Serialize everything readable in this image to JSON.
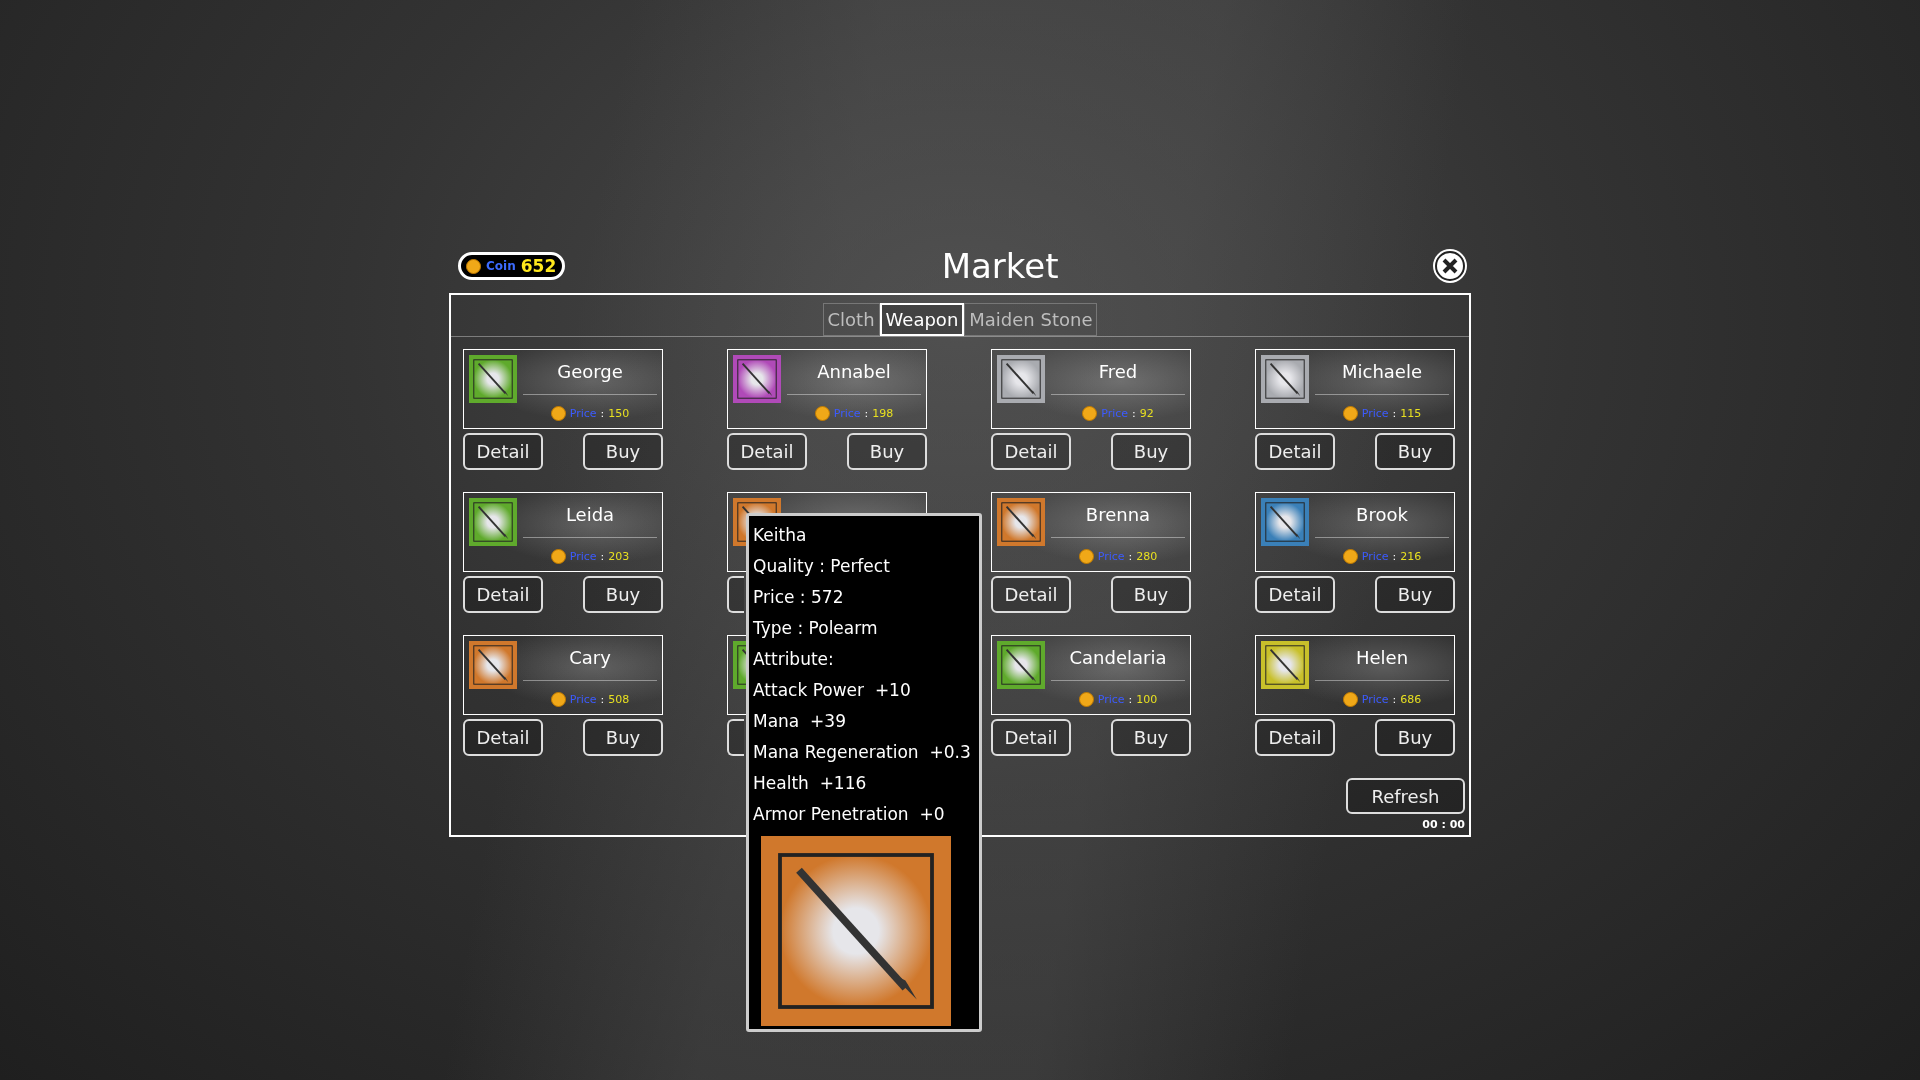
{
  "coin": {
    "label": "Coin",
    "amount": "652"
  },
  "title": "Market",
  "tabs": [
    {
      "label": "Cloth",
      "selected": false
    },
    {
      "label": "Weapon",
      "selected": true
    },
    {
      "label": "Maiden Stone",
      "selected": false
    }
  ],
  "items": [
    {
      "name": "George",
      "color": "#5faa2c",
      "price_label": "Price",
      "separator": ":",
      "price": "150",
      "buttons": [
        "Detail",
        "Buy"
      ]
    },
    {
      "name": "Annabel",
      "color": "#b04ab8",
      "price_label": "Price",
      "separator": ":",
      "price": "198",
      "buttons": [
        "Detail",
        "Buy"
      ]
    },
    {
      "name": "Fred",
      "color": "#a9abb0",
      "price_label": "Price",
      "separator": ":",
      "price": "92",
      "buttons": [
        "Detail",
        "Buy"
      ]
    },
    {
      "name": "Michaele",
      "color": "#a9abb0",
      "price_label": "Price",
      "separator": ":",
      "price": "115",
      "buttons": [
        "Detail",
        "Buy"
      ]
    },
    {
      "name": "Leida",
      "color": "#5faa2c",
      "price_label": "Price",
      "separator": ":",
      "price": "203",
      "buttons": [
        "Detail",
        "Buy"
      ]
    },
    {
      "color": "#d0782c"
    },
    {
      "name": "Brenna",
      "color": "#d0782c",
      "price_label": "Price",
      "separator": ":",
      "price": "280",
      "buttons": [
        "Detail",
        "Buy"
      ]
    },
    {
      "name": "Brook",
      "color": "#3a80b8",
      "price_label": "Price",
      "separator": ":",
      "price": "216",
      "buttons": [
        "Detail",
        "Buy"
      ]
    },
    {
      "name": "Cary",
      "color": "#d0782c",
      "price_label": "Price",
      "separator": ":",
      "price": "508",
      "buttons": [
        "Detail",
        "Buy"
      ]
    },
    {
      "color": "#5faa2c"
    },
    {
      "name": "Candelaria",
      "color": "#5faa2c",
      "price_label": "Price",
      "separator": ":",
      "price": "100",
      "buttons": [
        "Detail",
        "Buy"
      ]
    },
    {
      "name": "Helen",
      "color": "#c8c02a",
      "price_label": "Price",
      "separator": ":",
      "price": "686",
      "buttons": [
        "Detail",
        "Buy"
      ]
    }
  ],
  "refresh": "Refresh",
  "timer": "00 : 00",
  "tooltip": {
    "color": "#d0782c",
    "lines": [
      "Keitha",
      "Quality : Perfect",
      "Price : 572",
      "Type : Polearm",
      "Attribute:",
      "Attack Power  +10",
      "Mana  +39",
      "Mana Regeneration  +0.3",
      "Health  +116",
      "Armor Penetration  +0"
    ]
  }
}
